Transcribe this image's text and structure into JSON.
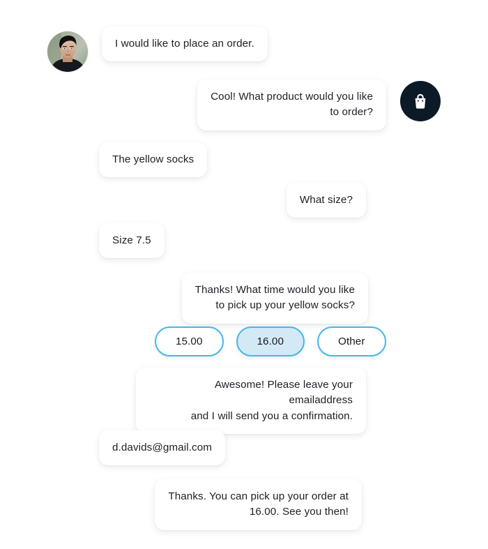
{
  "theme": {
    "page_background": "#ffffff",
    "bubble_background": "#ffffff",
    "bubble_text_color": "#1c1f24",
    "chip_border_color": "#45b6ea",
    "chip_selected_background": "#d4e9f6",
    "bot_avatar_background": "#0b1a26",
    "bot_avatar_icon_color": "#ffffff"
  },
  "conversation": {
    "messages": [
      {
        "id": "msg-1",
        "sender": "user",
        "text": "I would like to place an order.",
        "avatar_icon": "user-photo-avatar"
      },
      {
        "id": "msg-2",
        "sender": "agent",
        "text": "Cool! What product would you like\nto order?",
        "avatar_icon": "shopping-bag-icon"
      },
      {
        "id": "msg-3",
        "sender": "user",
        "text": "The yellow socks"
      },
      {
        "id": "msg-4",
        "sender": "agent",
        "text": "What size?"
      },
      {
        "id": "msg-5",
        "sender": "user",
        "text": "Size 7.5"
      },
      {
        "id": "msg-6",
        "sender": "agent",
        "text": "Thanks! What time would you like\nto pick up your yellow socks?"
      },
      {
        "id": "msg-7",
        "sender": "agent",
        "text": "Awesome! Please leave your emailaddress\nand I will send you a confirmation."
      },
      {
        "id": "msg-8",
        "sender": "user",
        "text": "d.davids@gmail.com"
      },
      {
        "id": "msg-9",
        "sender": "agent",
        "text": "Thanks. You can pick up your order at\n16.00. See you then!"
      }
    ],
    "quick_replies": [
      {
        "id": "chip-1500",
        "label": "15.00",
        "selected": false
      },
      {
        "id": "chip-1600",
        "label": "16.00",
        "selected": true
      },
      {
        "id": "chip-other",
        "label": "Other",
        "selected": false
      }
    ]
  }
}
